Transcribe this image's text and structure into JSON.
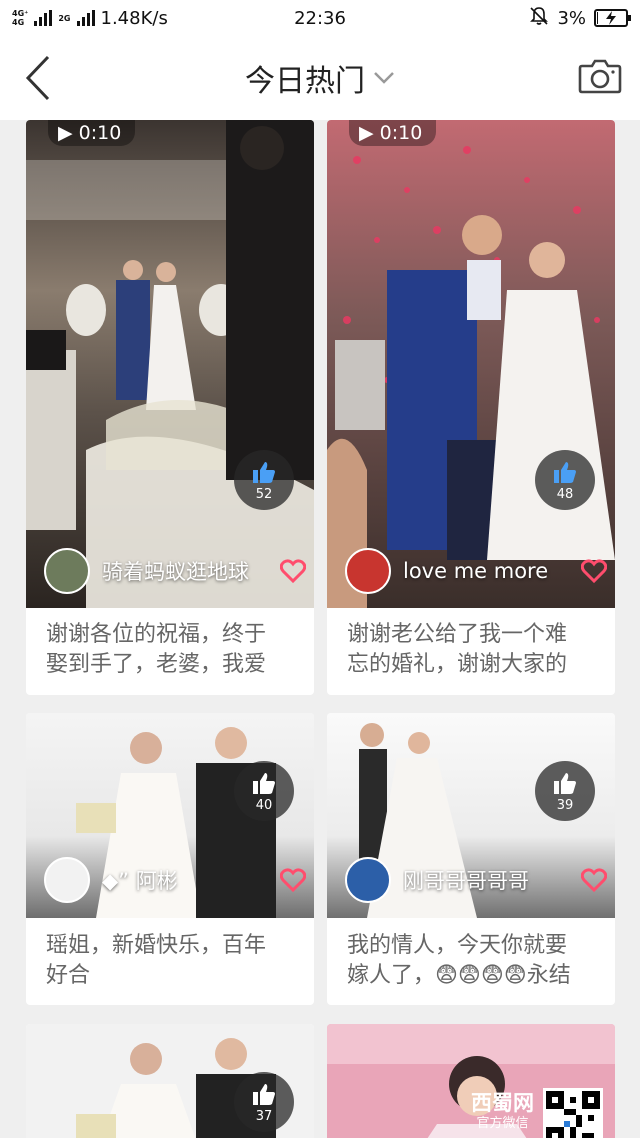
{
  "status_bar": {
    "network_tags": [
      "4G⁺",
      "4G",
      "2G"
    ],
    "network_tag_2g": "2G",
    "speed": "1.48K/s",
    "time": "22:36",
    "battery": "3%",
    "battery_level": 0.03
  },
  "header": {
    "title": "今日热门",
    "back_icon": "chevron-left-icon",
    "camera_icon": "camera-icon",
    "dropdown_icon": "chevron-down-icon"
  },
  "cards": [
    {
      "duration": "0:10",
      "likes": "52",
      "author": "骑着蚂蚁逛地球",
      "caption_line1": "谢谢各位的祝福，终于",
      "caption_line2": "娶到手了，老婆，我爱"
    },
    {
      "duration": "0:10",
      "likes": "48",
      "author": "love  me  more",
      "caption_line1": "谢谢老公给了我一个难",
      "caption_line2": "忘的婚礼，谢谢大家的"
    },
    {
      "likes": "40",
      "author": "◆”    阿彬",
      "caption_line1": "瑶姐，新婚快乐，百年",
      "caption_line2": "好合"
    },
    {
      "likes": "39",
      "author": "刚哥哥哥哥哥",
      "caption_line1": "我的情人，今天你就要",
      "caption_line2": "嫁人了，😨😨😨😨永结"
    },
    {
      "likes": "37"
    },
    {
      "watermark_brand": "西蜀网",
      "watermark_sub": "官方微信"
    }
  ],
  "colors": {
    "like_heart": "#ff4d6d",
    "background": "#efefef"
  }
}
